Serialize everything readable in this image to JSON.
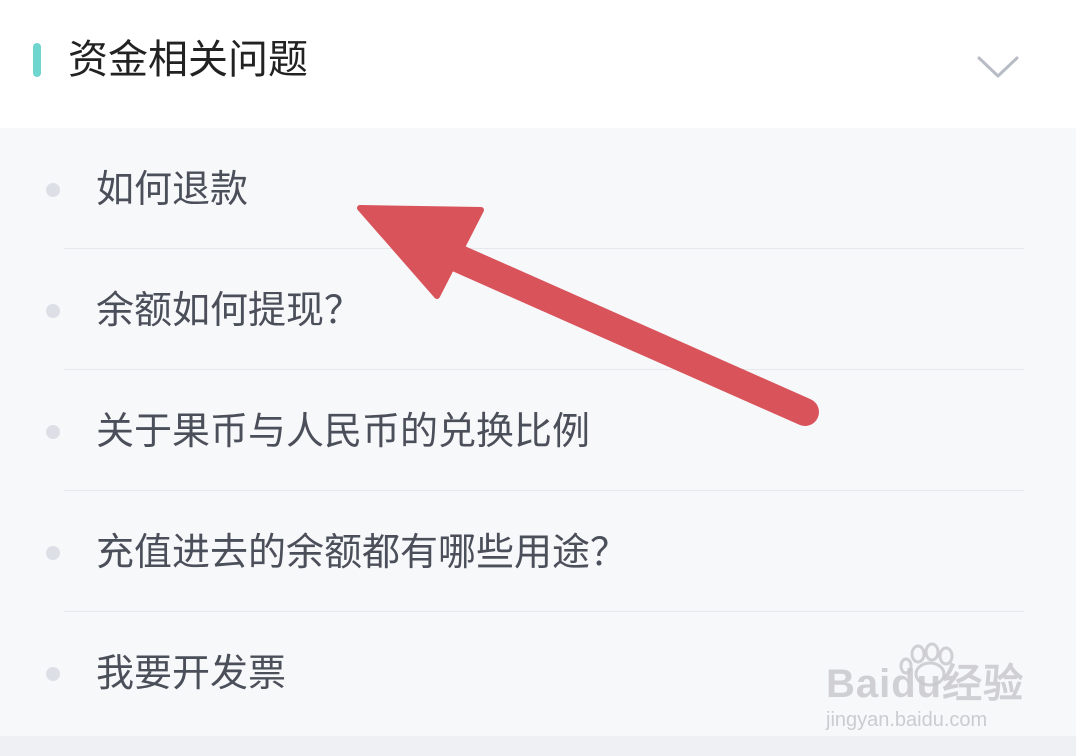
{
  "section": {
    "title": "资金相关问题"
  },
  "faq": {
    "items": [
      {
        "label": "如何退款"
      },
      {
        "label": "余额如何提现？"
      },
      {
        "label": "关于果币与人民币的兑换比例"
      },
      {
        "label": "充值进去的余额都有哪些用途？"
      },
      {
        "label": "我要开发票"
      }
    ]
  },
  "watermark": {
    "brand": "Baidu经验",
    "url": "jingyan.baidu.com"
  },
  "colors": {
    "accent": "#6fd6cf",
    "arrow": "#d9535a",
    "text": "#4a4f5a"
  },
  "icons": {
    "collapse": "chevron-down-icon",
    "bullet": "dot-icon",
    "annotation": "arrow-icon"
  }
}
